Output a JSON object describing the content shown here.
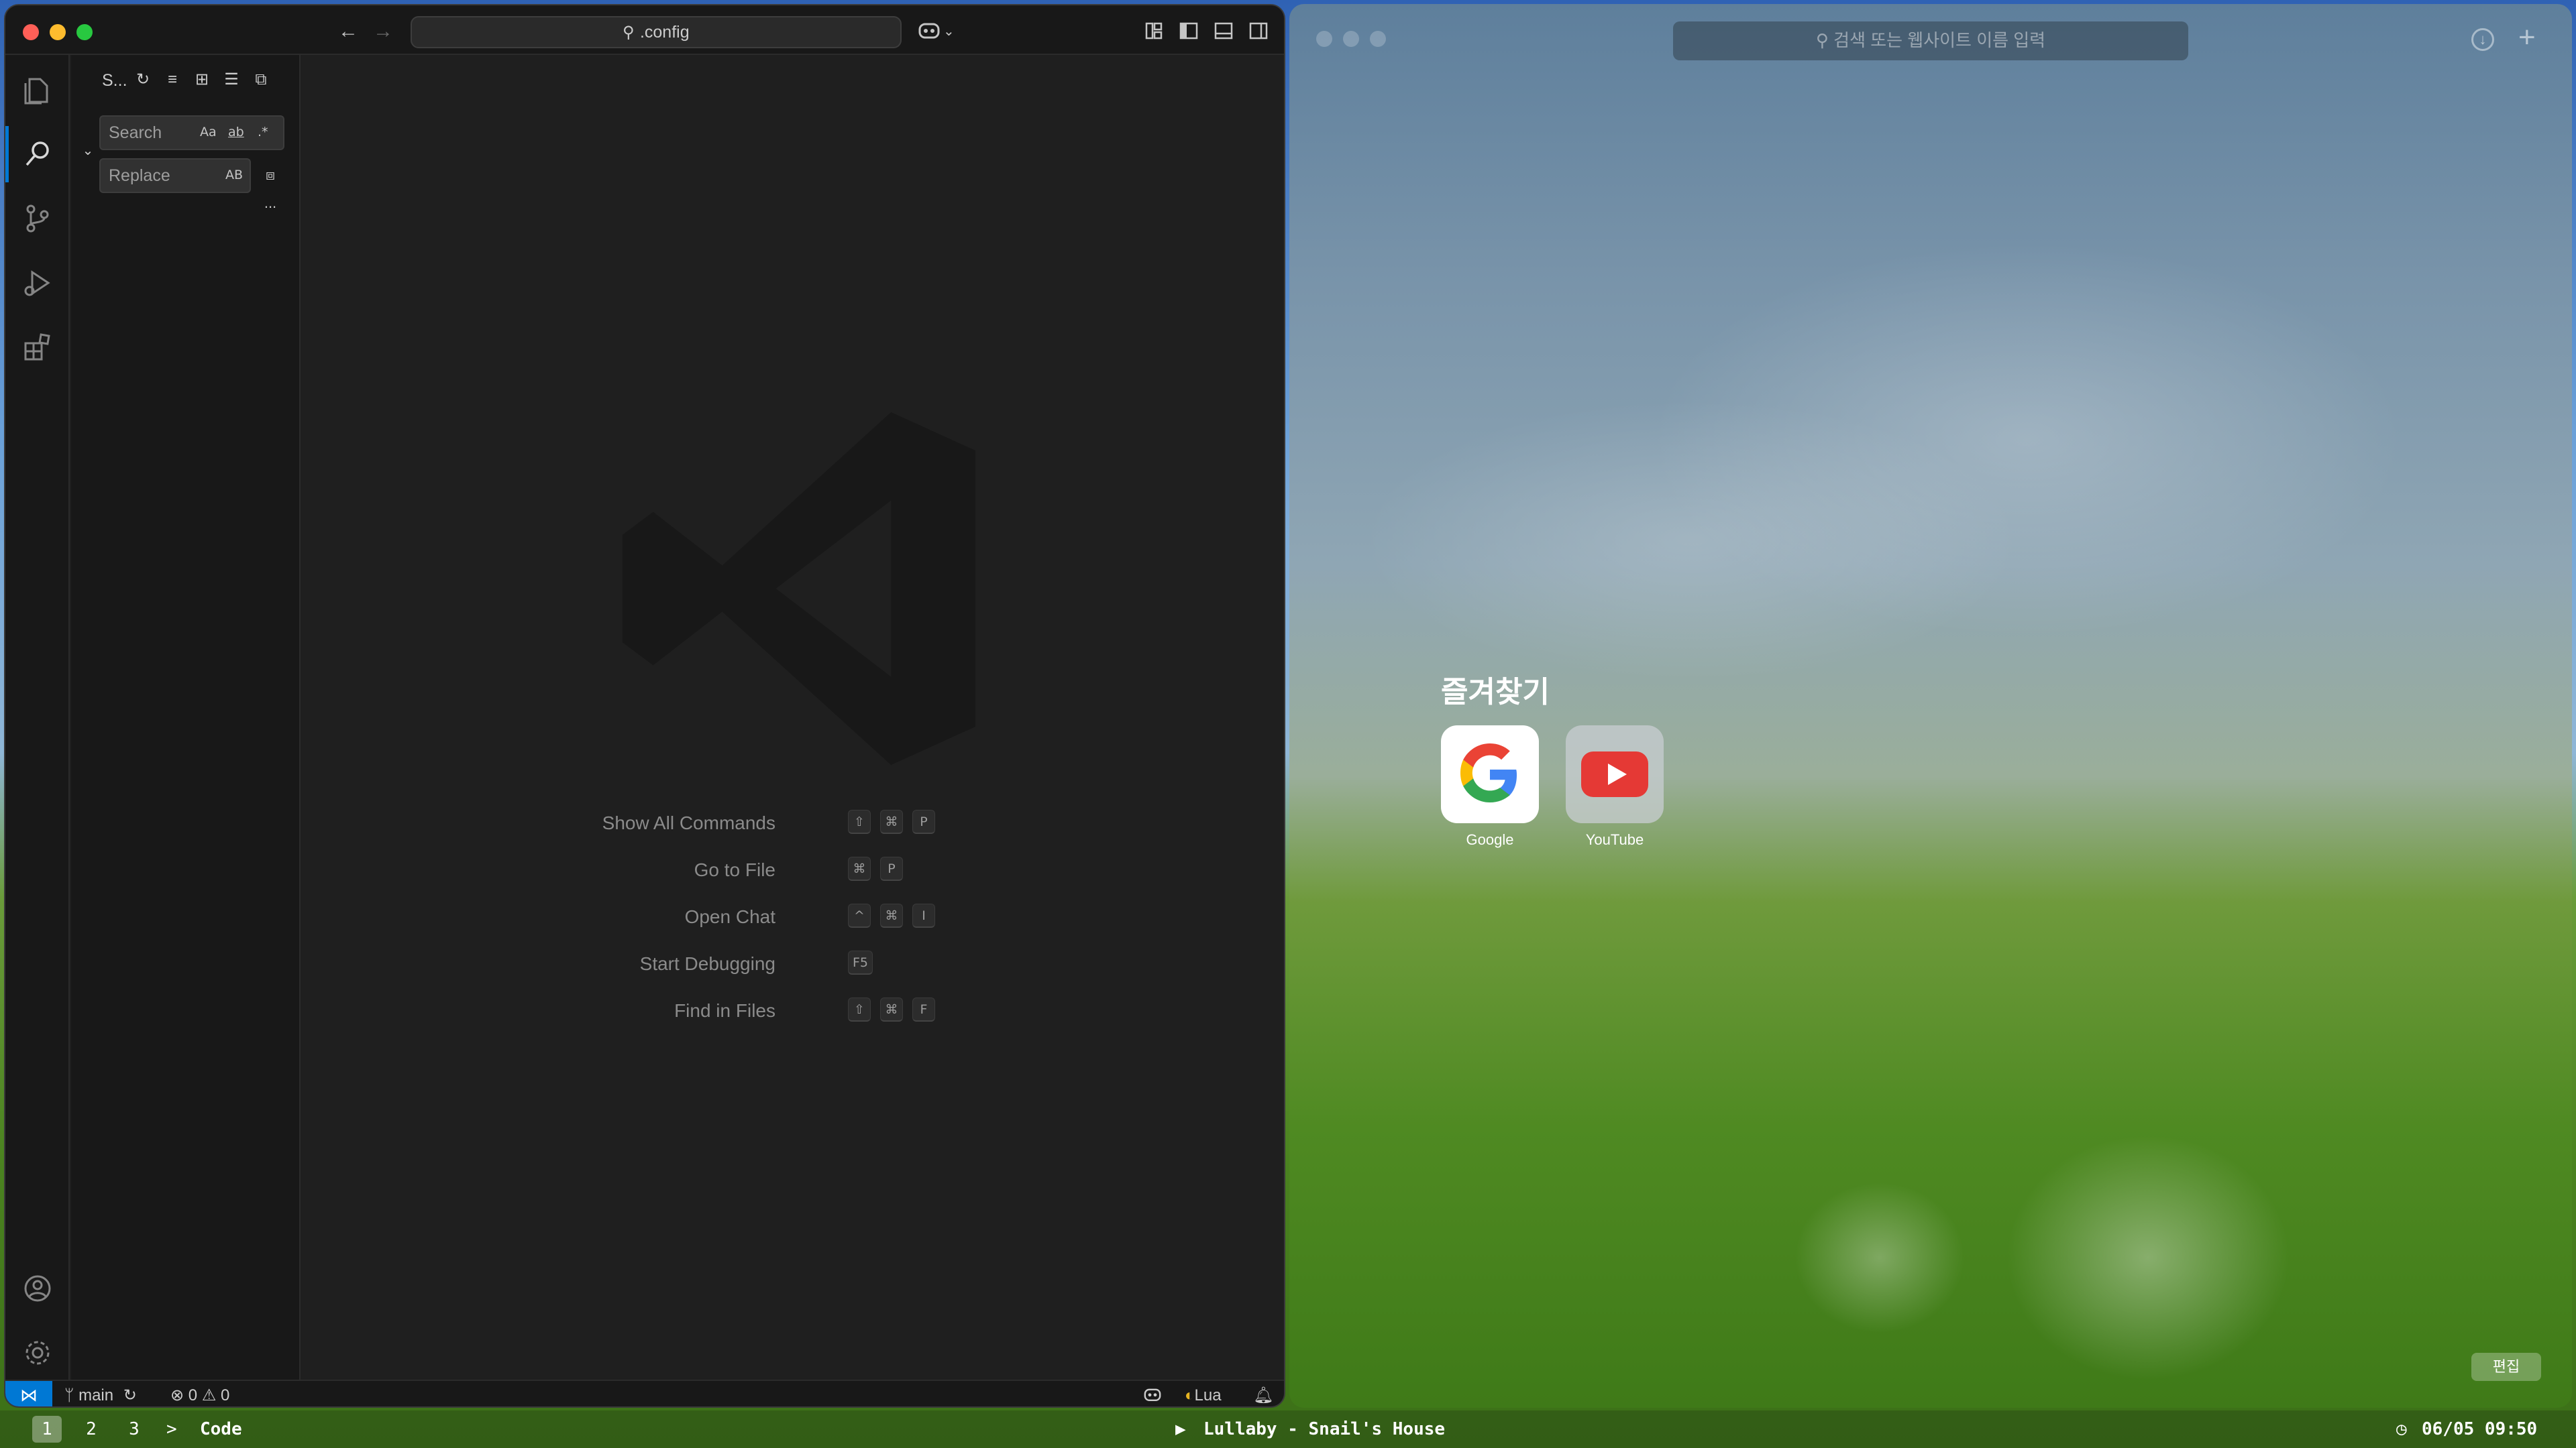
{
  "vscode": {
    "command_center": ".config",
    "sidebar": {
      "title": "S...",
      "search_placeholder": "Search",
      "replace_placeholder": "Replace",
      "search_opts": [
        "Aa",
        "ab",
        ".*"
      ],
      "replace_opt": "AB",
      "more": "..."
    },
    "hints": [
      {
        "label": "Show All Commands",
        "keys": [
          "⇧",
          "⌘",
          "P"
        ]
      },
      {
        "label": "Go to File",
        "keys": [
          "⌘",
          "P"
        ]
      },
      {
        "label": "Open Chat",
        "keys": [
          "^",
          "⌘",
          "I"
        ]
      },
      {
        "label": "Start Debugging",
        "keys": [
          "F5"
        ]
      },
      {
        "label": "Find in Files",
        "keys": [
          "⇧",
          "⌘",
          "F"
        ]
      }
    ],
    "statusbar": {
      "branch": "main",
      "errors": "0",
      "warnings": "0",
      "language": "Lua"
    }
  },
  "browser": {
    "url_placeholder": "검색 또는 웹사이트 이름 입력",
    "favorites_title": "즐겨찾기",
    "favorites": [
      {
        "name": "Google"
      },
      {
        "name": "YouTube"
      }
    ],
    "edit_label": "편집"
  },
  "bottombar": {
    "workspaces": [
      "1",
      "2",
      "3"
    ],
    "active_workspace": "1",
    "arrow": ">",
    "app": "Code",
    "now_playing": "Lullaby - Snail's House",
    "datetime": "06/05 09:50"
  },
  "colors": {
    "vscode_accent": "#0078d4",
    "youtube_red": "#ff0000"
  }
}
